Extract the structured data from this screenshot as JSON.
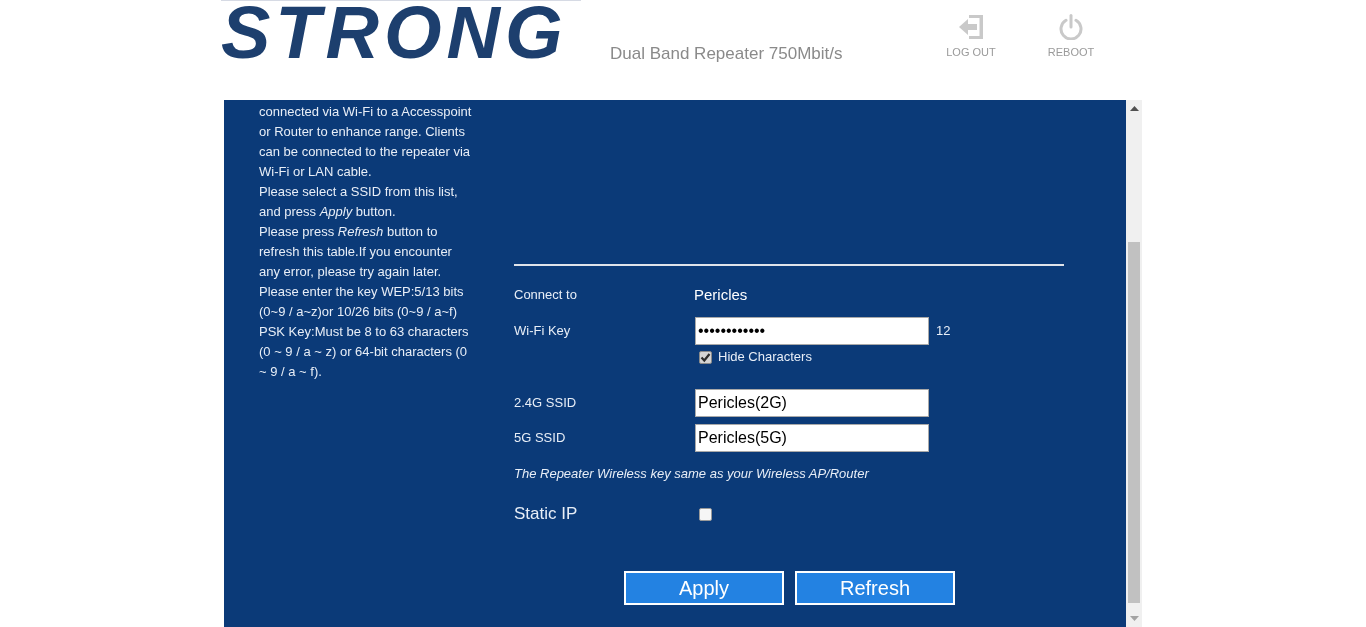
{
  "header": {
    "logo": "STRONG",
    "title": "Dual Band Repeater 750Mbit/s",
    "actions": [
      {
        "kind": "logout",
        "label": "LOG OUT"
      },
      {
        "kind": "reboot",
        "label": "REBOOT"
      }
    ]
  },
  "help_text": [
    "connected via Wi-Fi to a Accesspoint or Router to enhance range. Clients can be connected to the repeater via Wi-Fi or LAN cable.",
    "Please select a SSID from this list, and press *Apply* button.",
    "Please press *Refresh* button to refresh this table.If you encounter any error, please try again later.",
    "Please enter the key WEP:5/13 bits (0~9 / a~z)or 10/26 bits (0~9 / a~f)",
    "PSK Key:Must be 8 to 63 characters (0 ~ 9 / a ~ z) or 64-bit characters (0 ~ 9 / a ~ f)."
  ],
  "form": {
    "rows": [
      {
        "kind": "text",
        "label": "Connect to",
        "value": "Pericles"
      },
      {
        "kind": "password",
        "label": "Wi-Fi Key",
        "value": "••••••••••••",
        "length": "12",
        "hide_characters": {
          "label": "Hide Characters",
          "checked": true
        }
      },
      {
        "kind": "input",
        "label": "2.4G SSID",
        "value": "Pericles(2G)"
      },
      {
        "kind": "input",
        "label": "5G SSID",
        "value": "Pericles(5G)"
      },
      {
        "kind": "note",
        "text": "The Repeater Wireless key same as your Wireless AP/Router"
      },
      {
        "kind": "checkbox",
        "label": "Static IP",
        "checked": false
      }
    ]
  },
  "buttons": [
    "Apply",
    "Refresh"
  ]
}
